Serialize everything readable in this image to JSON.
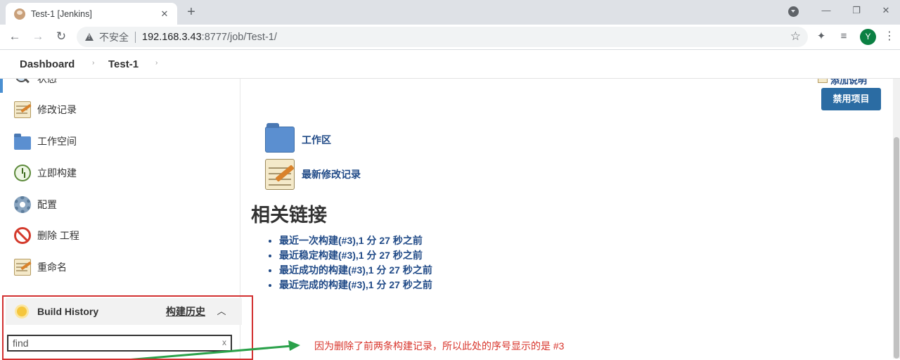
{
  "browser": {
    "tab_title": "Test-1 [Jenkins]",
    "tab_close": "✕",
    "new_tab": "+",
    "insecure_label": "不安全",
    "url_host": "192.168.3.43",
    "url_path": ":8777/job/Test-1/",
    "avatar_letter": "Y",
    "window_controls": [
      "—",
      "❐",
      "✕"
    ]
  },
  "breadcrumb": {
    "items": [
      "Dashboard",
      "Test-1"
    ],
    "separator": "›"
  },
  "sidebar": {
    "items": [
      {
        "label": "状态",
        "icon": "search-icon"
      },
      {
        "label": "修改记录",
        "icon": "notepad-icon"
      },
      {
        "label": "工作空间",
        "icon": "folder-icon"
      },
      {
        "label": "立即构建",
        "icon": "clock-icon"
      },
      {
        "label": "配置",
        "icon": "gear-icon"
      },
      {
        "label": "删除 工程",
        "icon": "ban-icon"
      },
      {
        "label": "重命名",
        "icon": "notepad-icon"
      }
    ],
    "build_history": {
      "title": "Build History",
      "trend_link": "构建历史",
      "collapse": "︿",
      "find_value": "find",
      "clear": "x"
    }
  },
  "main": {
    "add_description": "添加说明",
    "disable_button": "禁用项目",
    "workspace_link": "工作区",
    "changes_link": "最新修改记录",
    "section_title": "相关链接",
    "permalinks": [
      "最近一次构建(#3),1 分 27 秒之前",
      "最近稳定构建(#3),1 分 27 秒之前",
      "最近成功的构建(#3),1 分 27 秒之前",
      "最近完成的构建(#3),1 分 27 秒之前"
    ]
  },
  "annotation": {
    "text": "因为删除了前两条构建记录，所以此处的序号显示的是 #3",
    "color": "#d8342b",
    "arrow_color": "#2aa14a",
    "box_color": "#d23030"
  },
  "colors": {
    "link": "#204a87",
    "primary_button": "#2b6ca3"
  }
}
